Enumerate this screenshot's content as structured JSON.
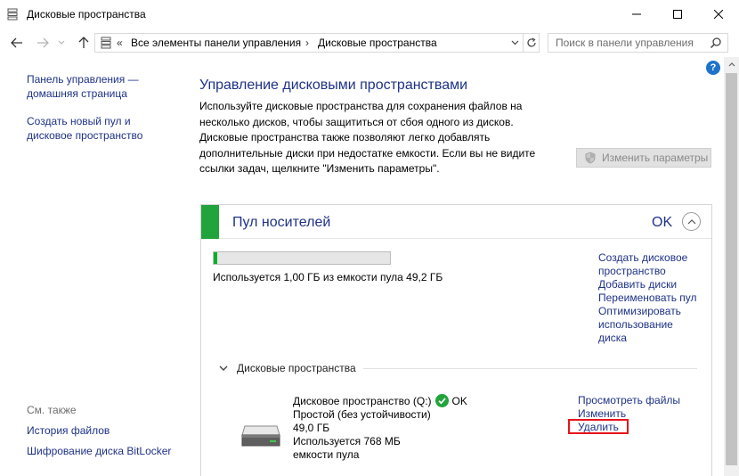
{
  "window": {
    "title": "Дисковые пространства"
  },
  "address": {
    "chevron": "«",
    "segment1": "Все элементы панели управления",
    "arrow": "›",
    "segment2": "Дисковые пространства"
  },
  "search": {
    "placeholder": "Поиск в панели управления"
  },
  "help_label": "?",
  "sidebar": {
    "home_link_line1": "Панель управления —",
    "home_link_line2": "домашняя страница",
    "create_link_line1": "Создать новый пул и",
    "create_link_line2": "дисковое пространство",
    "see_also": "См. также",
    "file_history": "История файлов",
    "bitlocker": "Шифрование диска BitLocker"
  },
  "main": {
    "heading": "Управление дисковыми пространствами",
    "description": "Используйте дисковые пространства для сохранения файлов на несколько дисков, чтобы защититься от сбоя одного из дисков. Дисковые пространства также позволяют легко добавлять дополнительные диски при недостатке емкости. Если вы не видите ссылки задач, щелкните \"Изменить параметры\".",
    "change_settings_button": "Изменить параметры"
  },
  "pool": {
    "title": "Пул носителей",
    "status": "OK",
    "usage_fraction": 0.02,
    "usage_text": "Используется 1,00 ГБ из емкости пула 49,2 ГБ",
    "links": {
      "create_space_line1": "Создать дисковое",
      "create_space_line2": "пространство",
      "add_disks": "Добавить диски",
      "rename_pool": "Переименовать пул",
      "optimize_line1": "Оптимизировать",
      "optimize_line2": "использование",
      "optimize_line3": "диска"
    },
    "spaces_section_title": "Дисковые пространства",
    "space": {
      "name": "Дисковое пространство (Q:)",
      "status": "OK",
      "resiliency": "Простой (без устойчивости)",
      "size": "49,0 ГБ",
      "used_line1": "Используется 768 МБ",
      "used_line2": "емкости пула",
      "links": {
        "view_files": "Просмотреть файлы",
        "change": "Изменить",
        "delete": "Удалить"
      }
    }
  },
  "colors": {
    "link": "#1e3287",
    "pool_status_green": "#21a43b",
    "usage_fill": "#06b025",
    "highlight_red": "#e8131b"
  }
}
